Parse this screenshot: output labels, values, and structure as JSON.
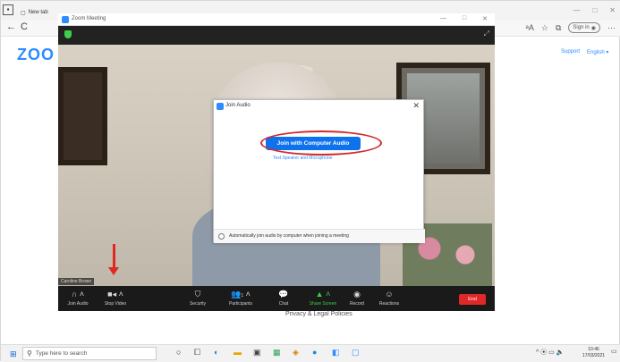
{
  "browser": {
    "tab_label": "New tab",
    "zoom_tab_label": "Zoom Meeting",
    "signin_label": "Sign in",
    "back_icon": "back-arrow-icon",
    "reload_char": "C"
  },
  "website": {
    "logo": "ZOO",
    "support": "Support",
    "english": "English ▾",
    "privacy": "Privacy & Legal Policies"
  },
  "zoom_window": {
    "title": "Zoom Meeting",
    "participant_name": "Caroline Brown"
  },
  "join_dialog": {
    "title": "Join Audio",
    "join_button": "Join with Computer Audio",
    "test_link": "Test Speaker and Microphone",
    "auto_join_label": "Automatically join audio by computer when joining a meeting"
  },
  "toolbar": {
    "join_audio": "Join Audio",
    "stop_video": "Stop Video",
    "security": "Security",
    "participants": "Participants",
    "participants_count": "1",
    "chat": "Chat",
    "share_screen": "Share Screen",
    "record": "Record",
    "reactions": "Reactions",
    "end": "End"
  },
  "taskbar": {
    "search_placeholder": "Type here to search",
    "time": "10:46",
    "date": "17/03/2021"
  },
  "colors": {
    "zoom_blue": "#0e72ed",
    "annotation_red": "#e0281f",
    "end_red": "#e02828",
    "share_green": "#3ccf4e"
  }
}
